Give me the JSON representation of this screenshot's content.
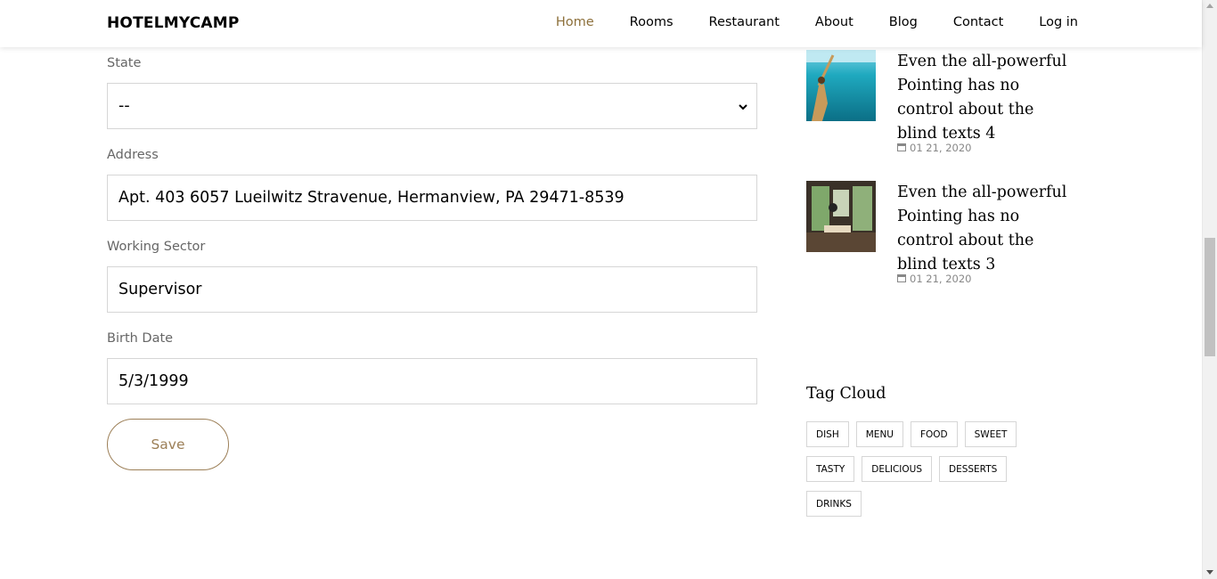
{
  "brand": "HOTELMYCAMP",
  "nav": {
    "items": [
      "Home",
      "Rooms",
      "Restaurant",
      "About",
      "Blog",
      "Contact",
      "Log in"
    ],
    "active": "Home"
  },
  "form": {
    "state": {
      "label": "State",
      "value": "--"
    },
    "address": {
      "label": "Address",
      "value": "Apt. 403 6057 Lueilwitz Stravenue, Hermanview, PA 29471-8539"
    },
    "working_sector": {
      "label": "Working Sector",
      "value": "Supervisor"
    },
    "birth_date": {
      "label": "Birth Date",
      "value": "5/3/1999"
    },
    "save_label": "Save"
  },
  "sidebar": {
    "posts": [
      {
        "title": "Even the all-powerful Pointing has no control about the blind texts 4",
        "date": "01 21, 2020"
      },
      {
        "title": "Even the all-powerful Pointing has no control about the blind texts 3",
        "date": "01 21, 2020"
      }
    ],
    "tag_cloud": {
      "title": "Tag Cloud",
      "tags": [
        "DISH",
        "MENU",
        "FOOD",
        "SWEET",
        "TASTY",
        "DELICIOUS",
        "DESSERTS",
        "DRINKS"
      ]
    }
  },
  "colors": {
    "accent": "#8d703b",
    "button_border": "#9c7f57"
  }
}
